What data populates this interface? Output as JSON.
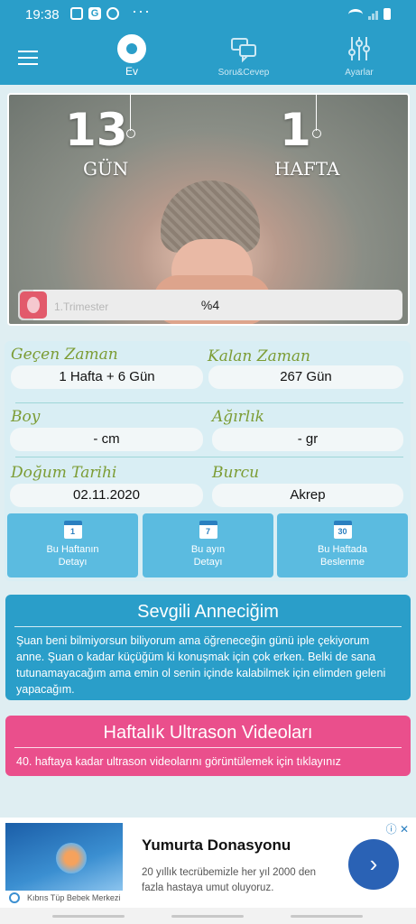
{
  "status_bar": {
    "time": "19:38",
    "dots": "···"
  },
  "nav": {
    "tabs": [
      {
        "label": "Ev",
        "icon": "baby-icon"
      },
      {
        "label": "Soru&Cevep",
        "icon": "chat-icon"
      },
      {
        "label": "Ayarlar",
        "icon": "sliders-icon"
      }
    ]
  },
  "hero": {
    "days_value": "13",
    "days_label": "GÜN",
    "weeks_value": "1",
    "weeks_label": "HAFTA",
    "trimester_label": "1.Trimester",
    "progress_text": "%4",
    "progress_fraction": 0.04
  },
  "info": {
    "elapsed_label": "Geçen Zaman",
    "elapsed_value": "1 Hafta + 6 Gün",
    "remaining_label": "Kalan Zaman",
    "remaining_value": "267 Gün",
    "height_label": "Boy",
    "height_value": "- cm",
    "weight_label": "Ağırlık",
    "weight_value": "- gr",
    "birth_label": "Doğum Tarihi",
    "birth_value": "02.11.2020",
    "zodiac_label": "Burcu",
    "zodiac_value": "Akrep"
  },
  "actions": [
    {
      "cal": "1",
      "line1": "Bu Haftanın",
      "line2": "Detayı"
    },
    {
      "cal": "7",
      "line1": "Bu ayın",
      "line2": "Detayı"
    },
    {
      "cal": "30",
      "line1": "Bu Haftada",
      "line2": "Beslenme"
    }
  ],
  "message_card": {
    "title": "Sevgili Anneciğim",
    "text": "Şuan beni bilmiyorsun biliyorum ama öğreneceğin günü iple çekiyorum anne. Şuan o kadar küçüğüm ki konuşmak için çok erken. Belki de sana tutunamayacağım ama emin ol senin içinde kalabilmek için elimden geleni yapacağım."
  },
  "video_card": {
    "title": "Haftalık Ultrason Videoları",
    "text": "40. haftaya kadar ultrason videolarını görüntülemek için tıklayınız"
  },
  "ad": {
    "title": "Yumurta Donasyonu",
    "description": "20 yıllık tecrübemizle her yıl 2000 den fazla hastaya umut oluyoruz.",
    "source": "Kıbrıs Tüp Bebek Merkezi",
    "badge": "ⓘ ✕",
    "cta": "›"
  },
  "colors": {
    "primary": "#2a9ec9",
    "accent_pink": "#ea4f8c",
    "label_green": "#7c9c34"
  }
}
